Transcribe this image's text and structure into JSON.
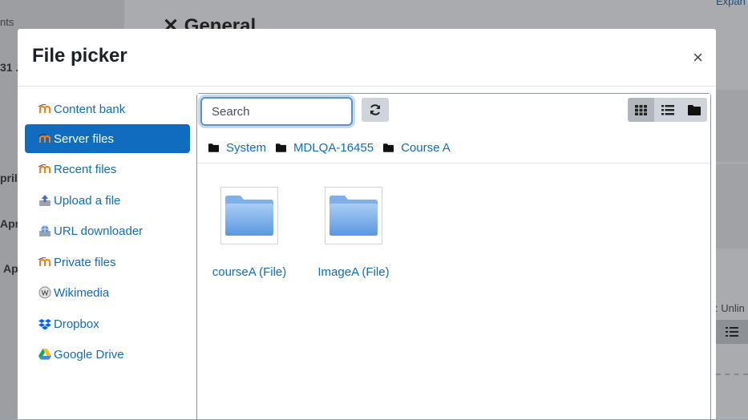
{
  "background": {
    "section_title": "General",
    "left_texts": [
      "nts",
      "31 ...",
      "pril",
      "Apr",
      "Ap"
    ],
    "top_right_link": "Expan",
    "right_text": ": Unlin"
  },
  "modal": {
    "title": "File picker",
    "close_symbol": "×"
  },
  "repositories": [
    {
      "label": "Content bank",
      "icon": "moodle-icon",
      "active": false
    },
    {
      "label": "Server files",
      "icon": "moodle-icon",
      "active": true
    },
    {
      "label": "Recent files",
      "icon": "moodle-icon",
      "active": false
    },
    {
      "label": "Upload a file",
      "icon": "upload-icon",
      "active": false
    },
    {
      "label": "URL downloader",
      "icon": "url-icon",
      "active": false
    },
    {
      "label": "Private files",
      "icon": "moodle-icon",
      "active": false
    },
    {
      "label": "Wikimedia",
      "icon": "wikimedia-icon",
      "active": false
    },
    {
      "label": "Dropbox",
      "icon": "dropbox-icon",
      "active": false
    },
    {
      "label": "Google Drive",
      "icon": "google-drive-icon",
      "active": false
    }
  ],
  "toolbar": {
    "search_placeholder": "Search",
    "views": [
      "grid-view",
      "list-view",
      "tree-view"
    ],
    "active_view": "grid-view"
  },
  "breadcrumb": [
    "System",
    "MDLQA-16455",
    "Course A"
  ],
  "files": [
    {
      "name": "courseA (File)"
    },
    {
      "name": "ImageA (File)"
    }
  ],
  "colors": {
    "accent": "#0f6cbf",
    "text": "#1d2125"
  }
}
